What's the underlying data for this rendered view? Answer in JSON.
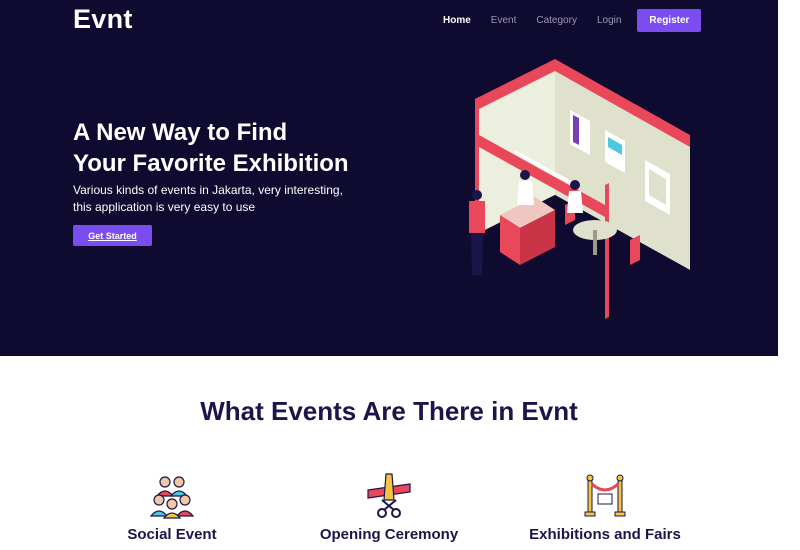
{
  "brand": "Evnt",
  "nav": {
    "items": [
      {
        "label": "Home",
        "active": true
      },
      {
        "label": "Event",
        "active": false
      },
      {
        "label": "Category",
        "active": false
      },
      {
        "label": "Login",
        "active": false
      }
    ],
    "register_label": "Register"
  },
  "hero": {
    "title_line1": "A New Way to Find",
    "title_line2": "Your Favorite Exhibition",
    "subtitle_line1": "Various kinds of events in Jakarta, very interesting,",
    "subtitle_line2": "this application is very easy to use",
    "cta_label": "Get Started"
  },
  "section": {
    "title": "What Events Are There in Evnt",
    "features": [
      {
        "label": "Social Event",
        "icon": "group-people-icon"
      },
      {
        "label": "Opening Ceremony",
        "icon": "ribbon-cutting-icon"
      },
      {
        "label": "Exhibitions and Fairs",
        "icon": "rope-barrier-icon"
      }
    ]
  },
  "colors": {
    "hero_bg": "#0f0a2f",
    "accent": "#7b4cf0",
    "heading": "#1b164a"
  }
}
